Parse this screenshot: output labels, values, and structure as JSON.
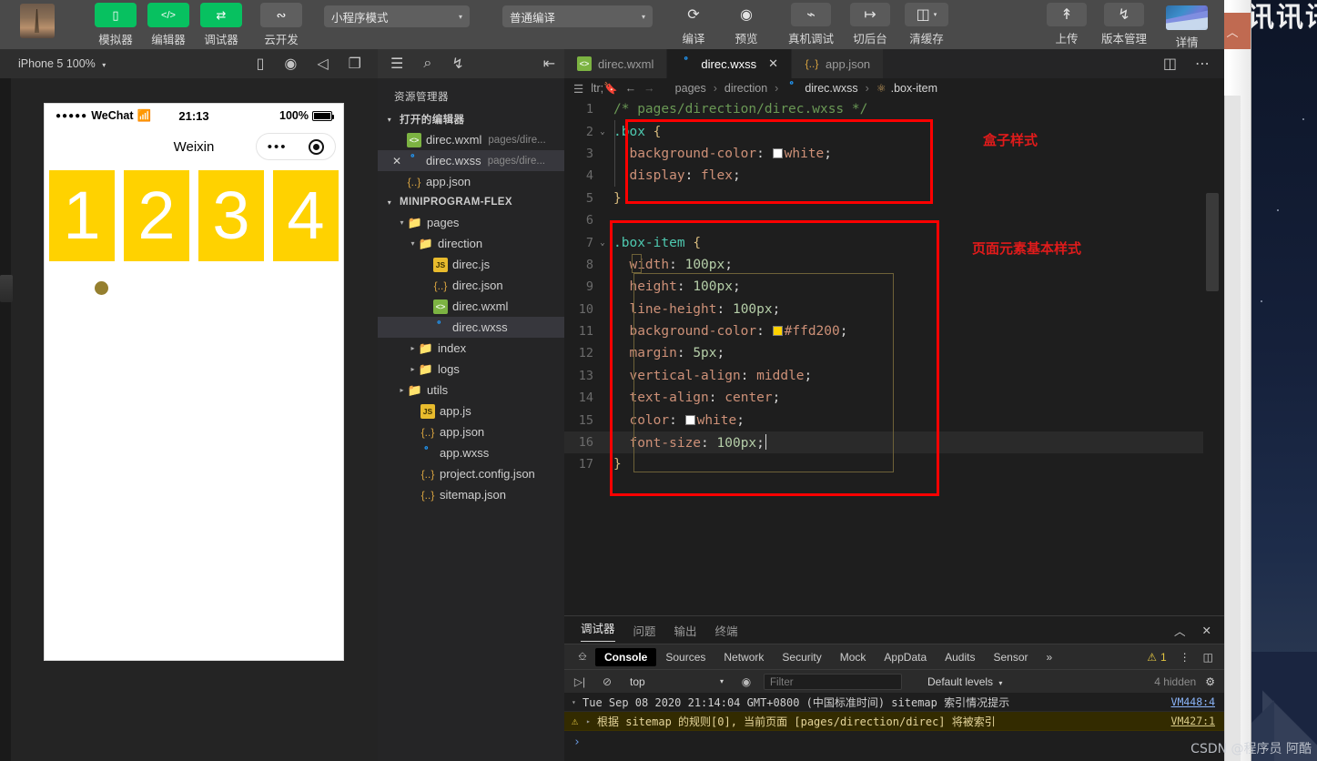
{
  "toolbar": {
    "app_thumb_name": "app-preview-thumbnail",
    "buttons": [
      {
        "label": "模拟器",
        "icon": "phone-icon",
        "glyph": "▯",
        "style": "green"
      },
      {
        "label": "编辑器",
        "icon": "code-icon",
        "glyph": "</>",
        "style": "green"
      },
      {
        "label": "调试器",
        "icon": "sliders-icon",
        "glyph": "⇄",
        "style": "green"
      },
      {
        "label": "云开发",
        "icon": "cloud-dev-icon",
        "glyph": "☁",
        "style": "grey"
      }
    ],
    "mode_select": {
      "value": "小程序模式",
      "caret": "▾"
    },
    "compile_select": {
      "value": "普通编译",
      "caret": "▾"
    },
    "actions": [
      {
        "label": "编译",
        "icon": "refresh-icon",
        "glyph": "⟳"
      },
      {
        "label": "预览",
        "icon": "eye-icon",
        "glyph": "👁"
      },
      {
        "label": "真机调试",
        "icon": "bug-icon",
        "glyph": "🐞"
      },
      {
        "label": "切后台",
        "icon": "background-switch-icon",
        "glyph": "↦"
      },
      {
        "label": "清缓存",
        "icon": "layers-icon",
        "glyph": "≋",
        "caret": "▾"
      }
    ],
    "right_actions": [
      {
        "label": "上传",
        "icon": "upload-icon",
        "glyph": "↥"
      },
      {
        "label": "版本管理",
        "icon": "branch-icon",
        "glyph": "⑂"
      },
      {
        "label": "详情",
        "icon": "detail-thumb-icon",
        "glyph": ""
      }
    ]
  },
  "subbar": {
    "device": "iPhone 5 100%",
    "device_caret": "▾",
    "sim_icons": [
      "phone-icon",
      "record-icon",
      "volume-icon",
      "windows-icon"
    ],
    "explorer_icons": [
      "files-icon",
      "search-icon",
      "source-control-icon"
    ],
    "collapse_icon": "collapse-panel-icon"
  },
  "tabs": {
    "items": [
      {
        "label": "direc.wxml",
        "icon": "wxml-file-icon",
        "active": false,
        "closable": false
      },
      {
        "label": "direc.wxss",
        "icon": "wxss-file-icon",
        "active": true,
        "closable": true,
        "close": "✕"
      },
      {
        "label": "app.json",
        "icon": "json-file-icon",
        "active": false,
        "closable": false
      }
    ],
    "right_icons": [
      "split-editor-icon",
      "more-actions-icon"
    ],
    "more_glyph": "⋯"
  },
  "breadcrumb": {
    "nav_icons": [
      "outline-icon",
      "bookmark-icon",
      "back-arrow-icon",
      "forward-arrow-icon"
    ],
    "back_glyph": "←",
    "forward_glyph": "→",
    "segments": [
      "pages",
      "direction",
      "direc.wxss",
      ".box-item"
    ],
    "separator": "›"
  },
  "explorer": {
    "title": "资源管理器",
    "open_editors": {
      "label": "打开的编辑器",
      "twisty": "▾",
      "items": [
        {
          "name": "direc.wxml",
          "path": "pages/dire...",
          "icon": "wxml-file-icon",
          "closable": false,
          "selected": false
        },
        {
          "name": "direc.wxss",
          "path": "pages/dire...",
          "icon": "wxss-file-icon",
          "closable": true,
          "close": "✕",
          "selected": true
        },
        {
          "name": "app.json",
          "path": "",
          "icon": "json-file-icon",
          "closable": false,
          "selected": false
        }
      ]
    },
    "project": {
      "label": "MINIPROGRAM-FLEX",
      "twisty": "▾",
      "tree": [
        {
          "name": "pages",
          "type": "folder",
          "icon": "folder-red-icon",
          "depth": 1,
          "twisty": "▾"
        },
        {
          "name": "direction",
          "type": "folder",
          "icon": "folder-blue-icon",
          "depth": 2,
          "twisty": "▾"
        },
        {
          "name": "direc.js",
          "type": "file",
          "icon": "js-file-icon",
          "depth": 3,
          "twisty": ""
        },
        {
          "name": "direc.json",
          "type": "file",
          "icon": "json-file-icon",
          "depth": 3,
          "twisty": ""
        },
        {
          "name": "direc.wxml",
          "type": "file",
          "icon": "wxml-file-icon",
          "depth": 3,
          "twisty": ""
        },
        {
          "name": "direc.wxss",
          "type": "file",
          "icon": "wxss-file-icon",
          "depth": 3,
          "twisty": "",
          "selected": true
        },
        {
          "name": "index",
          "type": "folder",
          "icon": "folder-blue-icon",
          "depth": 2,
          "twisty": "▸"
        },
        {
          "name": "logs",
          "type": "folder",
          "icon": "folder-olive-icon",
          "depth": 2,
          "twisty": "▸"
        },
        {
          "name": "utils",
          "type": "folder",
          "icon": "folder-green-icon",
          "depth": 1,
          "twisty": "▸"
        },
        {
          "name": "app.js",
          "type": "file",
          "icon": "js-file-icon",
          "depth": 2,
          "twisty": ""
        },
        {
          "name": "app.json",
          "type": "file",
          "icon": "json-file-icon",
          "depth": 2,
          "twisty": ""
        },
        {
          "name": "app.wxss",
          "type": "file",
          "icon": "wxss-file-icon",
          "depth": 2,
          "twisty": ""
        },
        {
          "name": "project.config.json",
          "type": "file",
          "icon": "json-file-icon",
          "depth": 2,
          "twisty": ""
        },
        {
          "name": "sitemap.json",
          "type": "file",
          "icon": "json-file-icon",
          "depth": 2,
          "twisty": ""
        }
      ]
    }
  },
  "editor": {
    "language": "wxss",
    "lines": [
      {
        "n": 1,
        "fold": "",
        "html": "<span class='t-comment'>/* pages/direction/direc.wxss */</span>"
      },
      {
        "n": 2,
        "fold": "⌄",
        "html": "<span class='t-sel'>.box</span> <span class='t-brace'>{</span>"
      },
      {
        "n": 3,
        "fold": "",
        "html": "  <span class='t-prop'>background-color</span><span class='t-punc'>:</span> <span class='sw sw-white'></span><span class='t-valname'>white</span><span class='t-punc'>;</span>"
      },
      {
        "n": 4,
        "fold": "",
        "html": "  <span class='t-prop'>display</span><span class='t-punc'>:</span> <span class='t-valname'>flex</span><span class='t-punc'>;</span>"
      },
      {
        "n": 5,
        "fold": "",
        "html": "<span class='t-brace'>}</span>"
      },
      {
        "n": 6,
        "fold": "",
        "html": ""
      },
      {
        "n": 7,
        "fold": "⌄",
        "html": "<span class='t-sel'>.box-item</span> <span class='t-brace'>{</span>"
      },
      {
        "n": 8,
        "fold": "",
        "html": "  <span class='t-prop'>width</span><span class='t-punc'>:</span> <span class='t-num'>100px</span><span class='t-punc'>;</span>"
      },
      {
        "n": 9,
        "fold": "",
        "html": "  <span class='t-prop'>height</span><span class='t-punc'>:</span> <span class='t-num'>100px</span><span class='t-punc'>;</span>"
      },
      {
        "n": 10,
        "fold": "",
        "html": "  <span class='t-prop'>line-height</span><span class='t-punc'>:</span> <span class='t-num'>100px</span><span class='t-punc'>;</span>"
      },
      {
        "n": 11,
        "fold": "",
        "html": "  <span class='t-prop'>background-color</span><span class='t-punc'>:</span> <span class='sw sw-yellow'></span><span class='t-valname'>#ffd200</span><span class='t-punc'>;</span>"
      },
      {
        "n": 12,
        "fold": "",
        "html": "  <span class='t-prop'>margin</span><span class='t-punc'>:</span> <span class='t-num'>5px</span><span class='t-punc'>;</span>"
      },
      {
        "n": 13,
        "fold": "",
        "html": "  <span class='t-prop'>vertical-align</span><span class='t-punc'>:</span> <span class='t-valname'>middle</span><span class='t-punc'>;</span>"
      },
      {
        "n": 14,
        "fold": "",
        "html": "  <span class='t-prop'>text-align</span><span class='t-punc'>:</span> <span class='t-valname'>center</span><span class='t-punc'>;</span>"
      },
      {
        "n": 15,
        "fold": "",
        "html": "  <span class='t-prop'>color</span><span class='t-punc'>:</span> <span class='sw sw-white'></span><span class='t-valname'>white</span><span class='t-punc'>;</span>"
      },
      {
        "n": 16,
        "fold": "",
        "html": "  <span class='t-prop'>font-size</span><span class='t-punc'>:</span> <span class='t-num'>100px</span><span class='t-punc'>;</span><span class='caret-bar'></span>",
        "highlight": true
      },
      {
        "n": 17,
        "fold": "",
        "html": "<span class='t-brace'>}</span>"
      }
    ],
    "annotations": [
      {
        "text": "盒子样式",
        "color": "#e01b1b"
      },
      {
        "text": "页面元素基本样式",
        "color": "#e01b1b"
      }
    ],
    "annotation_box_color": "#ff0000"
  },
  "debugger": {
    "panel_tabs": [
      "调试器",
      "问题",
      "输出",
      "终端"
    ],
    "panel_tabs_active": "调试器",
    "panel_right_icons": [
      "chevron-up-icon",
      "close-icon"
    ],
    "chevron_up": "︿",
    "close": "✕",
    "devtools_tabs": [
      "Console",
      "Sources",
      "Network",
      "Security",
      "Mock",
      "AppData",
      "Audits",
      "Sensor"
    ],
    "devtools_active": "Console",
    "overflow": "»",
    "warning_count": "1",
    "warning_glyph": "⚠",
    "kebab": "⋮",
    "dock_icon": "dock-panel-icon",
    "inspect_icon": "inspect-element-icon",
    "filter": {
      "execute_icon": "execute-icon",
      "clear_icon": "clear-console-icon",
      "context": "top",
      "context_caret": "▾",
      "eye_icon": "live-expression-icon",
      "placeholder": "Filter",
      "levels": "Default levels",
      "levels_caret": "▾",
      "hidden_count": "4 hidden",
      "settings_icon": "settings-gear-icon"
    },
    "logs": [
      {
        "type": "info",
        "twisty": "▾",
        "text": "Tue Sep 08 2020 21:14:04 GMT+0800 (中国标准时间) sitemap 索引情况提示",
        "source": "VM448:4"
      },
      {
        "type": "warn",
        "twisty": "▸",
        "icon": "warning-triangle-icon",
        "text": "根据 sitemap 的规则[0], 当前页面 [pages/direction/direc] 将被索引",
        "source": "VM427:1"
      }
    ],
    "prompt": "›"
  },
  "simulator": {
    "status_bar": {
      "carrier_dots": "●●●●●",
      "carrier": "WeChat",
      "wifi_icon": "wifi-icon",
      "wifi_glyph": "≋",
      "time": "21:13",
      "battery_percent": "100%",
      "battery_icon": "battery-full-icon"
    },
    "nav": {
      "title": "Weixin",
      "capsule_dots": "•••",
      "capsule_target_icon": "target-icon"
    },
    "box_items": [
      "1",
      "2",
      "3",
      "4"
    ],
    "item_bg_color": "#ffd200",
    "item_text_color": "#ffffff",
    "page_bg_color": "#ffffff",
    "cursor_name": "simulator-touch-cursor"
  },
  "desktop": {
    "wallpaper_name": "desktop-wallpaper",
    "bg_window_title_glyph": "︿",
    "logo_text": "腾讯讯讯"
  },
  "watermark": "CSDN @程序员 阿酷"
}
